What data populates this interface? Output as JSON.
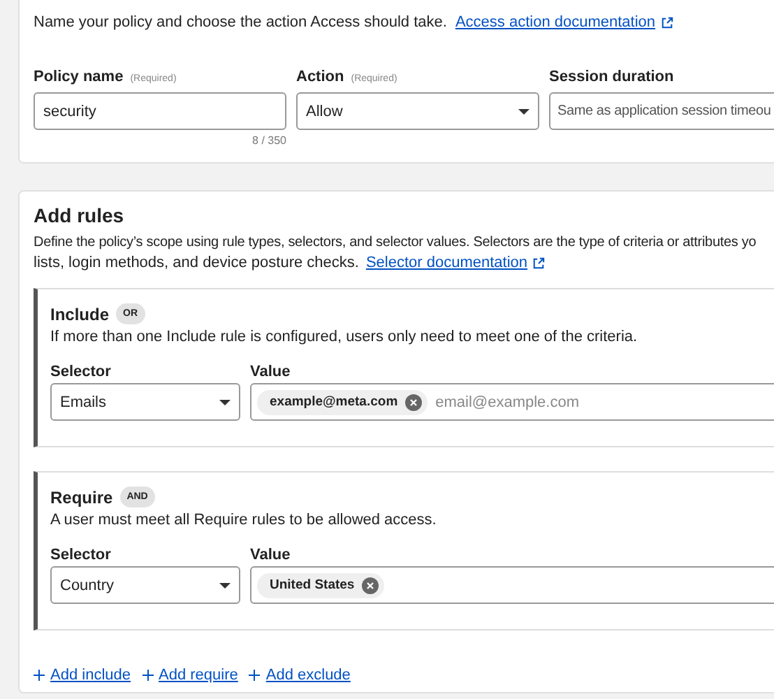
{
  "intro": {
    "text": "Name your policy and choose the action Access should take.",
    "link": "Access action documentation"
  },
  "fields": [
    {
      "kind": "text",
      "label": "Policy name",
      "required_note": "(Required)",
      "value": "security",
      "counter": "8 / 350"
    },
    {
      "kind": "select",
      "label": "Action",
      "required_note": "(Required)",
      "value": "Allow"
    },
    {
      "kind": "text",
      "label": "Session duration",
      "value": "Same as application session timeou"
    }
  ],
  "rules": {
    "title": "Add rules",
    "description": [
      "Define the policy’s scope using rule types, selectors, and selector values. Selectors are the type of criteria or attributes yo",
      "lists, login methods, and device posture checks."
    ],
    "link": "Selector documentation",
    "groups": [
      {
        "title": "Include",
        "badge": "OR",
        "description": "If more than one Include rule is configured, users only need to meet one of the criteria.",
        "selector_label": "Selector",
        "selector": "Emails",
        "value_label": "Value",
        "tags": [
          "example@meta.com"
        ],
        "placeholder": "email@example.com"
      },
      {
        "title": "Require",
        "badge": "AND",
        "description": "A user must meet all Require rules to be allowed access.",
        "selector_label": "Selector",
        "selector": "Country",
        "value_label": "Value",
        "tags": [
          "United States"
        ]
      }
    ],
    "add_links": [
      "Add include",
      "Add require",
      "Add exclude"
    ]
  }
}
